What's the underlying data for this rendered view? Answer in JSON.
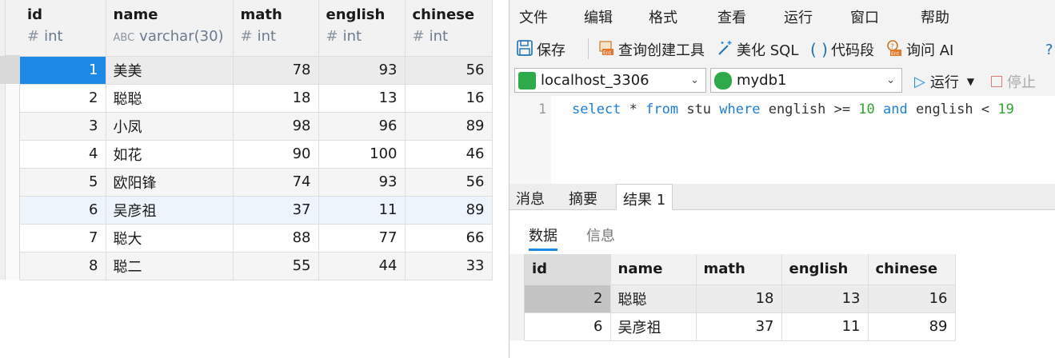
{
  "left_grid": {
    "columns": [
      {
        "name": "id",
        "type": "int",
        "type_icon": "hash-icon"
      },
      {
        "name": "name",
        "type": "varchar(30)",
        "type_icon": "text-type-icon"
      },
      {
        "name": "math",
        "type": "int",
        "type_icon": "hash-icon"
      },
      {
        "name": "english",
        "type": "int",
        "type_icon": "hash-icon"
      },
      {
        "name": "chinese",
        "type": "int",
        "type_icon": "hash-icon"
      }
    ],
    "rows": [
      [
        "1",
        "美美",
        "78",
        "93",
        "56"
      ],
      [
        "2",
        "聪聪",
        "18",
        "13",
        "16"
      ],
      [
        "3",
        "小凤",
        "98",
        "96",
        "89"
      ],
      [
        "4",
        "如花",
        "90",
        "100",
        "46"
      ],
      [
        "5",
        "欧阳锋",
        "74",
        "93",
        "56"
      ],
      [
        "6",
        "吴彦祖",
        "37",
        "11",
        "89"
      ],
      [
        "7",
        "聪大",
        "88",
        "77",
        "66"
      ],
      [
        "8",
        "聪二",
        "55",
        "44",
        "33"
      ]
    ]
  },
  "menu": [
    "文件",
    "编辑",
    "格式",
    "查看",
    "运行",
    "窗口",
    "帮助"
  ],
  "toolbar": {
    "save": "保存",
    "query_builder": "查询创建工具",
    "beautify": "美化 SQL",
    "snippet": "代码段",
    "ask_ai": "询问 AI"
  },
  "connection": {
    "server": "localhost_3306",
    "database": "mydb1",
    "run": "运行",
    "stop": "停止"
  },
  "editor": {
    "line_number": "1",
    "kw_select": "select",
    "star": " * ",
    "kw_from": "from",
    "table": " stu ",
    "kw_where": "where",
    "col1": " english >= ",
    "num1": "10",
    "kw_and": " and",
    "col2": " english < ",
    "num2": "19"
  },
  "result_tabs": [
    "消息",
    "摘要",
    "结果 1"
  ],
  "sub_tabs": [
    "数据",
    "信息"
  ],
  "result_grid": {
    "columns": [
      "id",
      "name",
      "math",
      "english",
      "chinese"
    ],
    "rows": [
      [
        "2",
        "聪聪",
        "18",
        "13",
        "16"
      ],
      [
        "6",
        "吴彦祖",
        "37",
        "11",
        "89"
      ]
    ]
  },
  "colors": {
    "selection_blue": "#1e88e5",
    "keyword_blue": "#1c7ed6",
    "number_green": "#2fa52f"
  }
}
